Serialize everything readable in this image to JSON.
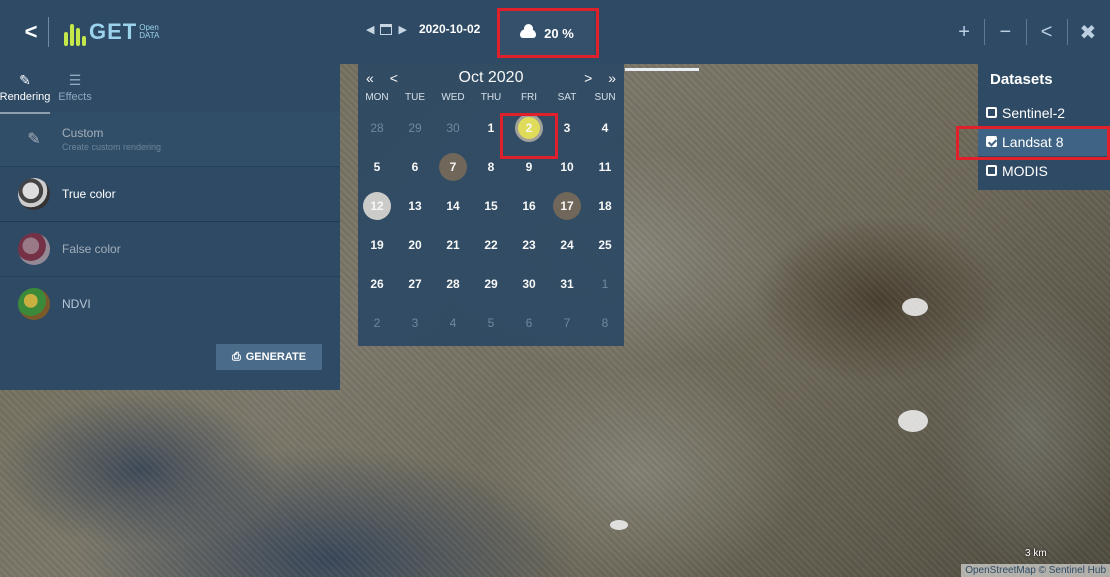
{
  "app": {
    "name": "GET",
    "name_sub": "Open DATA"
  },
  "header": {
    "back_glyph": "<",
    "date": "2020-10-02",
    "cloud_coverage": "20 %",
    "actions": {
      "zoom_in": "+",
      "zoom_out": "−",
      "share": "<",
      "close": "✖"
    }
  },
  "left_panel": {
    "tabs": [
      {
        "label": "Rendering",
        "icon": "brush-icon"
      },
      {
        "label": "Effects",
        "icon": "sliders-icon"
      }
    ],
    "items": [
      {
        "label": "Custom",
        "sub": "Create custom rendering"
      },
      {
        "label": "True color"
      },
      {
        "label": "False color"
      },
      {
        "label": "NDVI"
      }
    ],
    "generate_label": "GENERATE"
  },
  "calendar": {
    "month_label": "Oct 2020",
    "prev_year": "«",
    "prev_month": "<",
    "next_month": ">",
    "next_year": "»",
    "weekdays": [
      "MON",
      "TUE",
      "WED",
      "THU",
      "FRI",
      "SAT",
      "SUN"
    ],
    "weeks": [
      [
        "28",
        "29",
        "30",
        "1",
        "2",
        "3",
        "4"
      ],
      [
        "5",
        "6",
        "7",
        "8",
        "9",
        "10",
        "11"
      ],
      [
        "12",
        "13",
        "14",
        "15",
        "16",
        "17",
        "18"
      ],
      [
        "19",
        "20",
        "21",
        "22",
        "23",
        "24",
        "25"
      ],
      [
        "26",
        "27",
        "28",
        "29",
        "30",
        "31",
        "1"
      ],
      [
        "2",
        "3",
        "4",
        "5",
        "6",
        "7",
        "8"
      ]
    ]
  },
  "datasets": {
    "title": "Datasets",
    "items": [
      {
        "label": "Sentinel-2",
        "checked": false
      },
      {
        "label": "Landsat 8",
        "checked": true
      },
      {
        "label": "MODIS",
        "checked": false
      }
    ]
  },
  "map": {
    "scale_label": "3 km",
    "attribution": "OpenStreetMap  © Sentinel Hub"
  },
  "colors": {
    "panel": "#2e4a64",
    "highlight": "#e0202a",
    "selected_day": "#e6e25a"
  }
}
